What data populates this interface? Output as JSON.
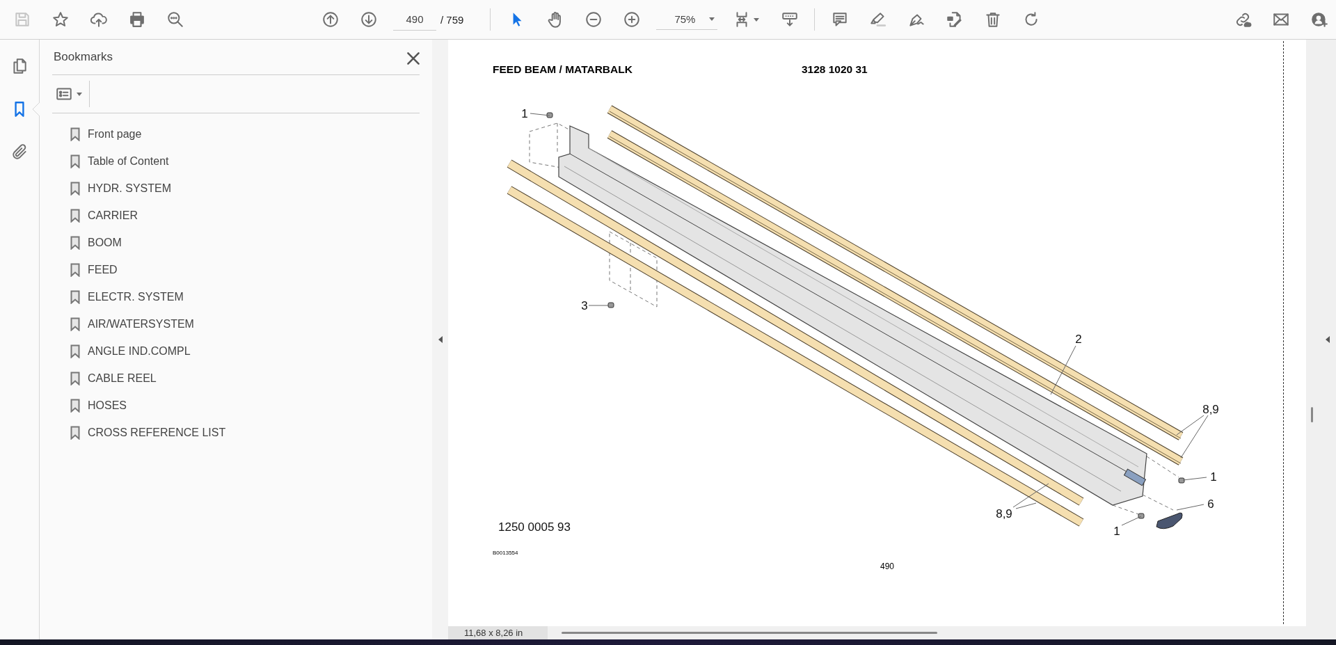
{
  "toolbar": {
    "save": {
      "disabled": true
    },
    "page_input": "490",
    "page_total": "/ 759",
    "tools": [
      {
        "kind": "select",
        "selected": true
      },
      {
        "kind": "hand",
        "selected": false
      }
    ],
    "zoom": "75%"
  },
  "left_rail": [
    {
      "kind": "pages",
      "selected": false
    },
    {
      "kind": "bookmarks",
      "selected": true
    },
    {
      "kind": "attachments",
      "selected": false
    }
  ],
  "sidebar": {
    "title": "Bookmarks",
    "items": [
      {
        "label": "Front page"
      },
      {
        "label": "Table of Content"
      },
      {
        "label": "HYDR. SYSTEM"
      },
      {
        "label": "CARRIER"
      },
      {
        "label": "BOOM"
      },
      {
        "label": "FEED"
      },
      {
        "label": "ELECTR. SYSTEM"
      },
      {
        "label": "AIR/WATERSYSTEM"
      },
      {
        "label": "ANGLE IND.COMPL"
      },
      {
        "label": "CABLE REEL"
      },
      {
        "label": "HOSES"
      },
      {
        "label": "CROSS REFERENCE LIST"
      }
    ]
  },
  "page": {
    "title": "FEED BEAM / MATARBALK",
    "part_number": "3128 1020 31",
    "callouts": [
      "1",
      "3",
      "2",
      "8,9",
      "1",
      "6",
      "1",
      "8,9"
    ],
    "drawing_number": "1250 0005 93",
    "reference": "B0013554",
    "page_number": "490"
  },
  "status_bar": {
    "page_size": "11,68 x 8,26 in"
  }
}
